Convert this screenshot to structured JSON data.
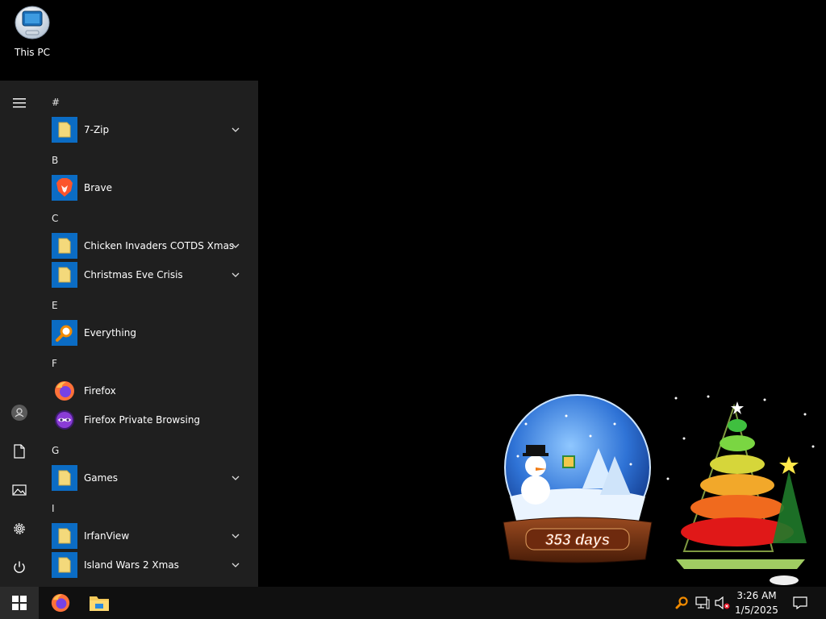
{
  "desktop": {
    "icons": [
      {
        "label": "This PC",
        "icon": "computer-icon"
      }
    ]
  },
  "start_menu": {
    "rail": [
      "hamburger-menu-icon",
      "user-account-icon",
      "documents-icon",
      "pictures-icon",
      "settings-gear-icon",
      "power-icon"
    ],
    "groups": [
      {
        "letter": "#",
        "apps": [
          {
            "name": "7-Zip",
            "icon": "folder-icon",
            "expandable": true
          }
        ]
      },
      {
        "letter": "B",
        "apps": [
          {
            "name": "Brave",
            "icon": "brave-lion-icon",
            "expandable": false
          }
        ]
      },
      {
        "letter": "C",
        "apps": [
          {
            "name": "Chicken Invaders COTDS Xmas",
            "icon": "folder-icon",
            "expandable": true
          },
          {
            "name": "Christmas Eve Crisis",
            "icon": "folder-icon",
            "expandable": true
          }
        ]
      },
      {
        "letter": "E",
        "apps": [
          {
            "name": "Everything",
            "icon": "magnifier-icon",
            "expandable": false
          }
        ]
      },
      {
        "letter": "F",
        "apps": [
          {
            "name": "Firefox",
            "icon": "firefox-icon",
            "expandable": false
          },
          {
            "name": "Firefox Private Browsing",
            "icon": "firefox-private-icon",
            "expandable": false
          }
        ]
      },
      {
        "letter": "G",
        "apps": [
          {
            "name": "Games",
            "icon": "folder-icon",
            "expandable": true
          }
        ]
      },
      {
        "letter": "I",
        "apps": [
          {
            "name": "IrfanView",
            "icon": "folder-icon",
            "expandable": true
          },
          {
            "name": "Island Wars 2 Xmas",
            "icon": "folder-icon",
            "expandable": true
          }
        ]
      }
    ]
  },
  "taskbar": {
    "start_icon": "windows-logo-icon",
    "pinned": [
      "firefox-icon",
      "file-explorer-icon"
    ],
    "tray": [
      "everything-search-icon",
      "network-icon",
      "volume-muted-icon",
      "notifications-icon"
    ],
    "clock": {
      "time": "3:26 AM",
      "date": "1/5/2025"
    }
  },
  "gadgets": {
    "snow_globe": {
      "days_label": "353 days"
    },
    "xmas_tree": {
      "icon": "christmas-tree-icon"
    }
  },
  "colors": {
    "desktop_bg": "#000000",
    "start_menu_bg": "#1f1f1f",
    "taskbar_bg": "#101010",
    "tile_blue": "#0b6cc4",
    "folder_yellow": "#f4d97b"
  }
}
